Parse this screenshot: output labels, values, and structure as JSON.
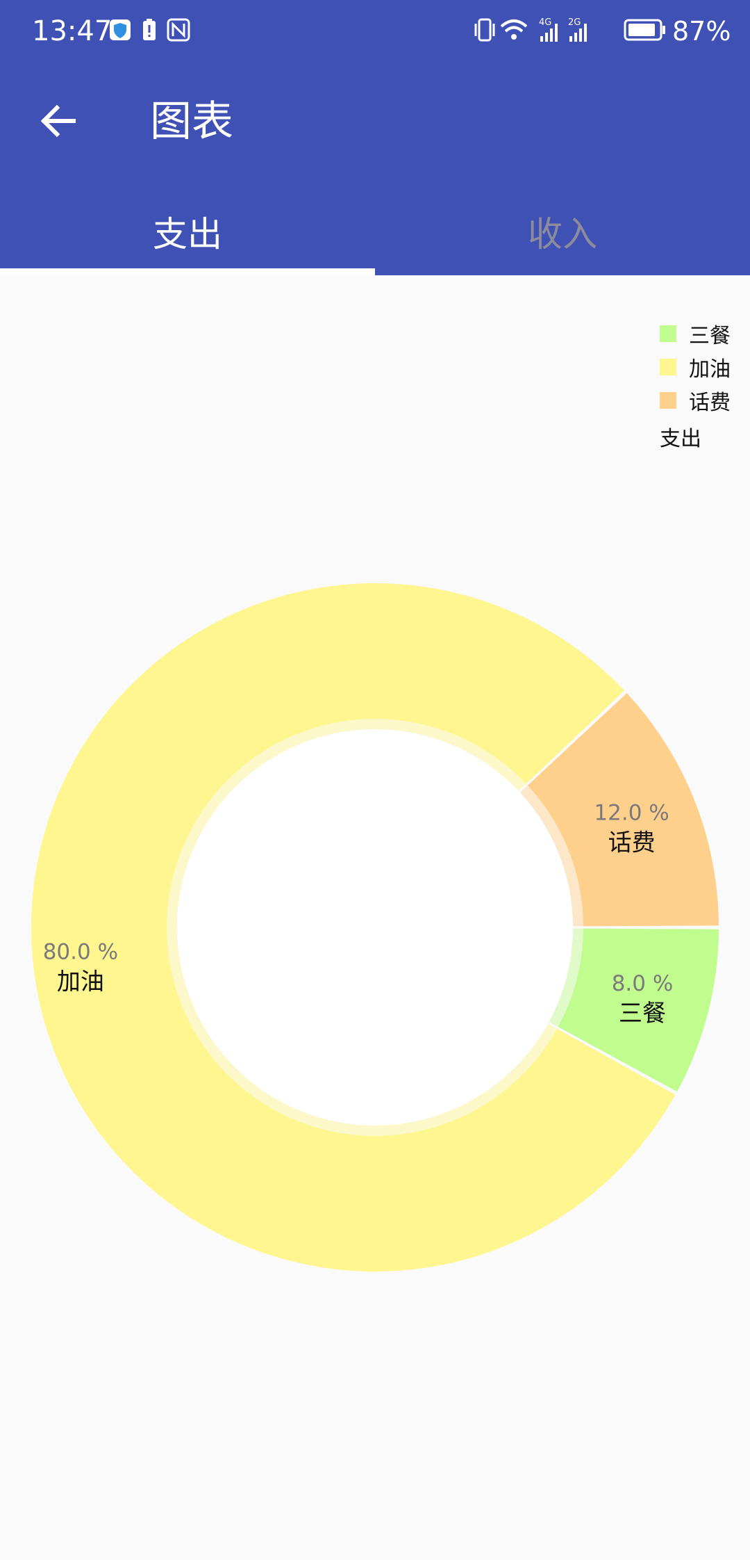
{
  "status_bar": {
    "time": "13:47",
    "battery_percent": "87%",
    "icons": [
      "shield-icon",
      "battery-alert-icon",
      "nfc-icon",
      "vibrate-icon",
      "wifi-icon",
      "signal-4g-icon",
      "signal-2g-icon",
      "battery-icon"
    ]
  },
  "toolbar": {
    "title": "图表",
    "back_icon": "arrow-left-icon"
  },
  "tabs": [
    {
      "label": "支出",
      "active": true
    },
    {
      "label": "收入",
      "active": false
    }
  ],
  "colors": {
    "header": "#3f51b5",
    "background": "#fafafa"
  },
  "chart_data": {
    "type": "pie",
    "title": "支出",
    "legend_position": "top-right",
    "slices": [
      {
        "label": "三餐",
        "value": 8.0,
        "percent_label": "8.0 %",
        "color": "#c0fc8e"
      },
      {
        "label": "加油",
        "value": 80.0,
        "percent_label": "80.0 %",
        "color": "#fff68f"
      },
      {
        "label": "话费",
        "value": 12.0,
        "percent_label": "12.0 %",
        "color": "#ffd08c"
      }
    ]
  }
}
